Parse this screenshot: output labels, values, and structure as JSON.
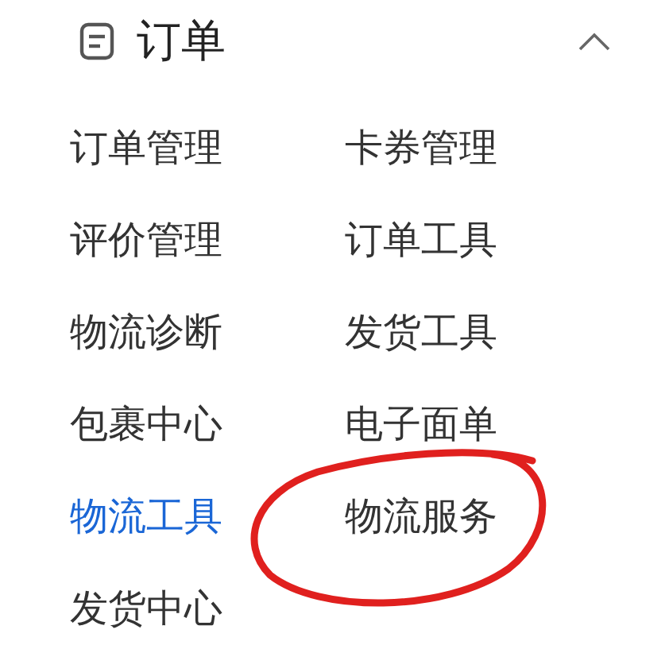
{
  "section": {
    "title": "订单",
    "expanded": true
  },
  "items": [
    {
      "label": "订单管理",
      "selected": false
    },
    {
      "label": "卡券管理",
      "selected": false
    },
    {
      "label": "评价管理",
      "selected": false
    },
    {
      "label": "订单工具",
      "selected": false
    },
    {
      "label": "物流诊断",
      "selected": false
    },
    {
      "label": "发货工具",
      "selected": false
    },
    {
      "label": "包裹中心",
      "selected": false
    },
    {
      "label": "电子面单",
      "selected": false
    },
    {
      "label": "物流工具",
      "selected": true
    },
    {
      "label": "物流服务",
      "selected": false
    },
    {
      "label": "发货中心",
      "selected": false
    }
  ],
  "annotations": [
    {
      "kind": "circle"
    }
  ]
}
